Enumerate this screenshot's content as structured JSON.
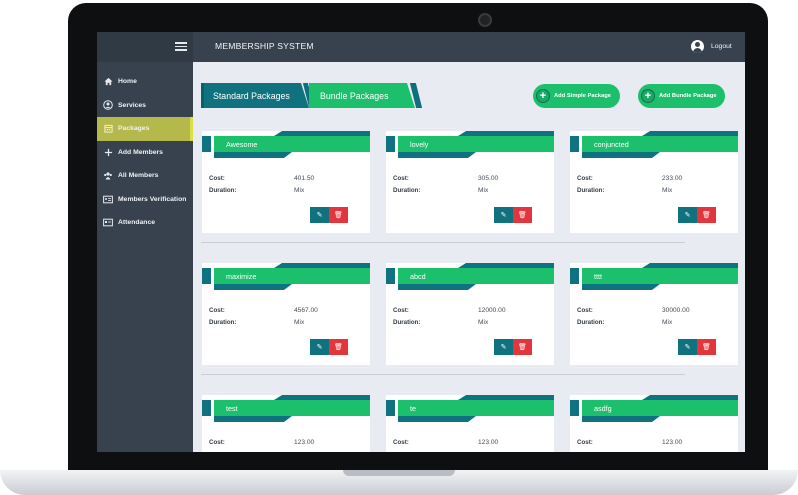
{
  "app": {
    "title": "MEMBERSHIP SYSTEM",
    "logout": "Logout"
  },
  "sidebar": {
    "items": [
      {
        "label": "Home",
        "icon": "home-icon"
      },
      {
        "label": "Services",
        "icon": "user-circle-icon"
      },
      {
        "label": "Packages",
        "icon": "calendar-icon",
        "active": true
      },
      {
        "label": "Add Members",
        "icon": "plus-icon"
      },
      {
        "label": "All Members",
        "icon": "users-icon"
      },
      {
        "label": "Members Verification",
        "icon": "id-card-icon"
      },
      {
        "label": "Attendance",
        "icon": "card-icon"
      }
    ]
  },
  "tabs": [
    {
      "label": "Standard Packages",
      "active": true
    },
    {
      "label": "Bundle Packages",
      "active": false
    }
  ],
  "actions": {
    "add_simple": "Add Simple Package",
    "add_bundle": "Add Bundle Package"
  },
  "card_labels": {
    "cost": "Cost:",
    "duration": "Duration:"
  },
  "packages": [
    {
      "name": "Awesome",
      "cost": "401.50",
      "duration": "Mix"
    },
    {
      "name": "lovely",
      "cost": "305.00",
      "duration": "Mix"
    },
    {
      "name": "conjuncted",
      "cost": "233.00",
      "duration": "Mix"
    },
    {
      "name": "maximize",
      "cost": "4567.00",
      "duration": "Mix"
    },
    {
      "name": "abcd",
      "cost": "12000.00",
      "duration": "Mix"
    },
    {
      "name": "tttt",
      "cost": "30000.00",
      "duration": "Mix"
    },
    {
      "name": "test",
      "cost": "123.00",
      "duration": ""
    },
    {
      "name": "te",
      "cost": "123.00",
      "duration": ""
    },
    {
      "name": "asdfg",
      "cost": "123.00",
      "duration": ""
    }
  ],
  "colors": {
    "sidebar": "#37424e",
    "active": "#b5b84a",
    "green": "#1bbf6c",
    "teal": "#11727f",
    "danger": "#e2353e",
    "background": "#e9ebf3"
  }
}
